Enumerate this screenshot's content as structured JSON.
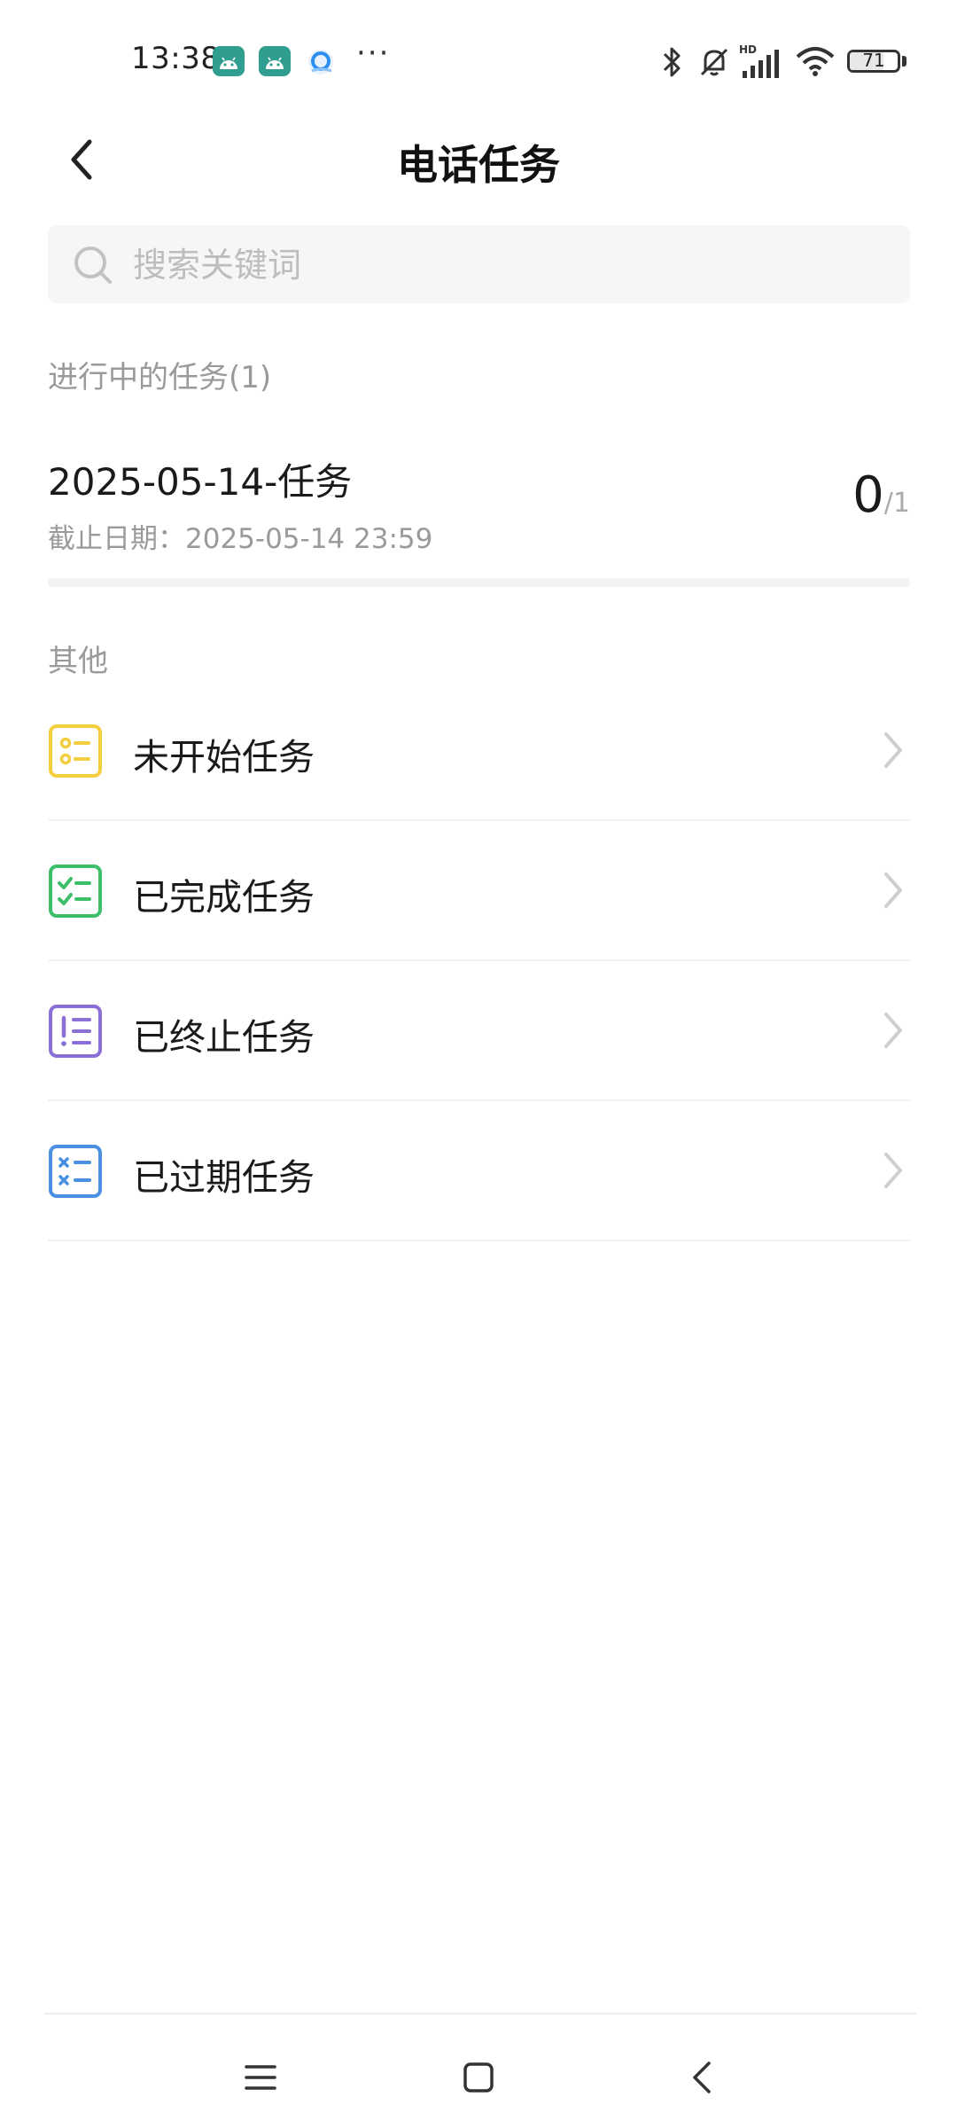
{
  "status_bar": {
    "time": "13:38",
    "more": "···",
    "battery": "71",
    "battery_level": 0.71,
    "icons": [
      "android-icon",
      "android-icon",
      "browser-icon",
      "bluetooth-icon",
      "mute-icon",
      "signal-icon",
      "wifi-icon",
      "battery-icon"
    ]
  },
  "header": {
    "title": "电话任务",
    "back_icon": "chevron-left-icon"
  },
  "search": {
    "placeholder": "搜索关键词",
    "value": ""
  },
  "ongoing": {
    "section_title": "进行中的任务(1)",
    "tasks": [
      {
        "name": "2025-05-14-任务",
        "deadline": "截止日期：2025-05-14 23:59",
        "done": "0",
        "total": "/1"
      }
    ]
  },
  "other": {
    "section_title": "其他",
    "items": [
      {
        "label": "未开始任务",
        "icon": "list-pending-icon",
        "color": "#f3cf3f"
      },
      {
        "label": "已完成任务",
        "icon": "list-checked-icon",
        "color": "#3dbf6a"
      },
      {
        "label": "已终止任务",
        "icon": "list-terminated-icon",
        "color": "#8a6fd6"
      },
      {
        "label": "已过期任务",
        "icon": "list-expired-icon",
        "color": "#4a90e2"
      }
    ]
  },
  "nav_bar": {
    "icons": [
      "menu-icon",
      "home-square-icon",
      "back-icon"
    ]
  },
  "colors": {
    "text_primary": "#1a1a1a",
    "text_secondary": "#9a9a9a",
    "divider": "#f3f3f3",
    "search_bg": "#f6f6f6"
  }
}
